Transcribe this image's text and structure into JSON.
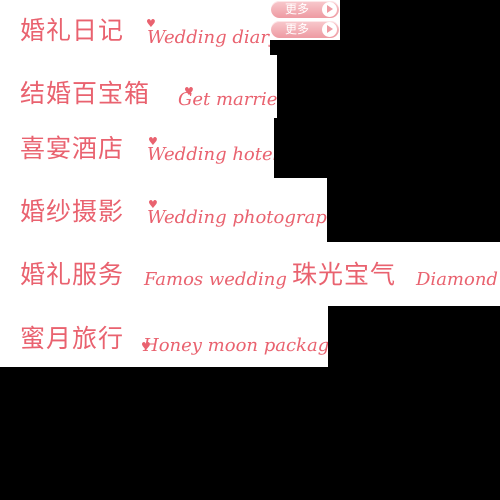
{
  "colors": {
    "accent": "#e9626f",
    "background": "#ffffff",
    "button": "#ee9aa2"
  },
  "buttons": {
    "more_1": "更多",
    "more_2": "更多"
  },
  "items": [
    {
      "cn": "婚礼日记",
      "en": "Wedding diary"
    },
    {
      "cn": "结婚百宝箱",
      "en": "Get married"
    },
    {
      "cn": "喜宴酒店",
      "en": "Wedding hotel"
    },
    {
      "cn": "婚纱摄影",
      "en": "Wedding photography"
    },
    {
      "cn": "婚礼服务",
      "en": "Famos wedding"
    },
    {
      "cn": "珠光宝气",
      "en": "Diamond"
    },
    {
      "cn": "蜜月旅行",
      "en": "Honey moon packages"
    }
  ]
}
